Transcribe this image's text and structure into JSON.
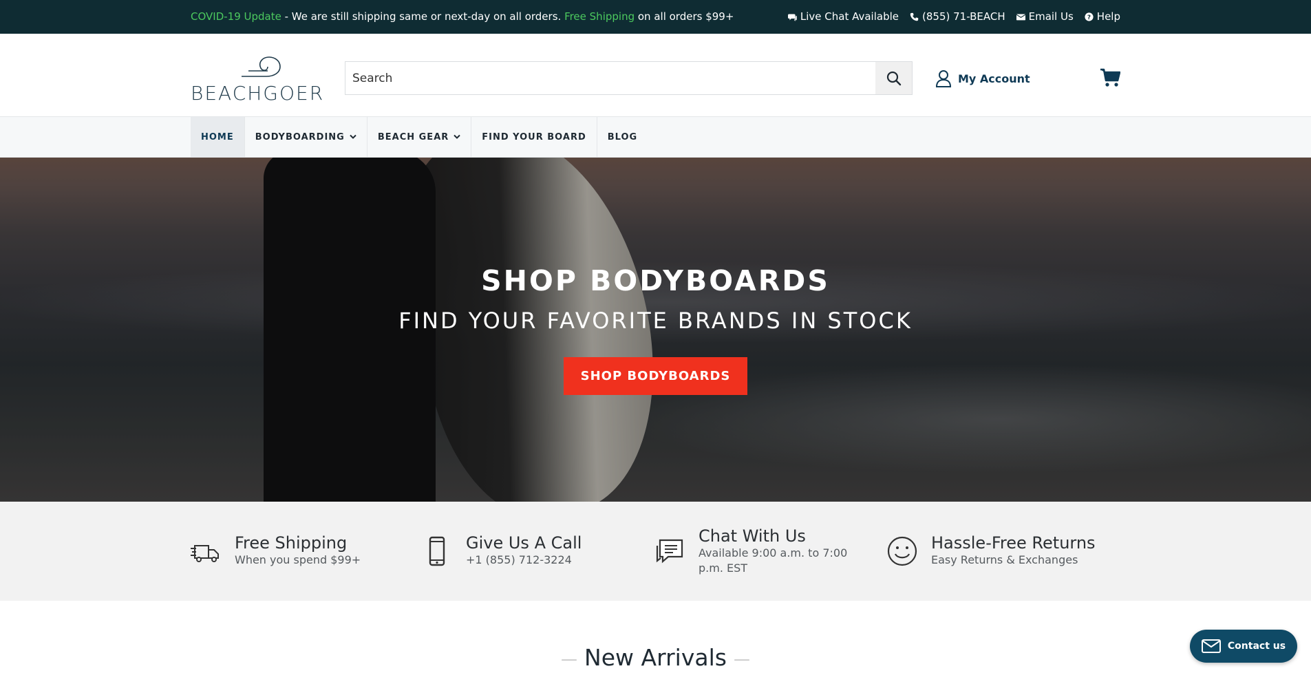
{
  "topbar": {
    "covid_label": "COVID-19 Update",
    "message": " - We are still shipping same or next-day on all orders. ",
    "free_shipping_label": "Free Shipping",
    "free_shipping_suffix": " on all orders $99+",
    "links": [
      {
        "icon": "chat-bubble-icon",
        "label": "Live Chat Available"
      },
      {
        "icon": "phone-icon",
        "label": "(855) 71-BEACH"
      },
      {
        "icon": "envelope-icon",
        "label": "Email Us"
      },
      {
        "icon": "question-circle-icon",
        "label": "Help"
      }
    ]
  },
  "header": {
    "logo_text": "BEACHGOER",
    "search_placeholder": "Search",
    "account_label": "My Account"
  },
  "nav": {
    "items": [
      {
        "label": "HOME",
        "active": true,
        "dropdown": false
      },
      {
        "label": "BODYBOARDING",
        "active": false,
        "dropdown": true
      },
      {
        "label": "BEACH GEAR",
        "active": false,
        "dropdown": true
      },
      {
        "label": "FIND YOUR BOARD",
        "active": false,
        "dropdown": false
      },
      {
        "label": "BLOG",
        "active": false,
        "dropdown": false
      }
    ]
  },
  "hero": {
    "title": "SHOP BODYBOARDS",
    "subtitle": "FIND YOUR FAVORITE BRANDS IN STOCK",
    "cta_label": "SHOP BODYBOARDS"
  },
  "features": [
    {
      "icon": "truck-icon",
      "title": "Free Shipping",
      "subtitle": "When you spend $99+"
    },
    {
      "icon": "mobile-phone-icon",
      "title": "Give Us A Call",
      "subtitle": "+1 (855) 712-3224"
    },
    {
      "icon": "chat-icon",
      "title": "Chat With Us",
      "subtitle": "Available 9:00 a.m. to 7:00 p.m. EST"
    },
    {
      "icon": "smiley-icon",
      "title": "Hassle-Free Returns",
      "subtitle": "Easy Returns & Exchanges"
    }
  ],
  "arrivals": {
    "title": "New Arrivals"
  },
  "contact": {
    "label": "Contact us"
  },
  "colors": {
    "topbar_bg": "#0f2c33",
    "accent_green": "#4cc95e",
    "brand_navy": "#0f3a55",
    "cta_red": "#f0311e",
    "features_bg": "#f2f2f2"
  }
}
